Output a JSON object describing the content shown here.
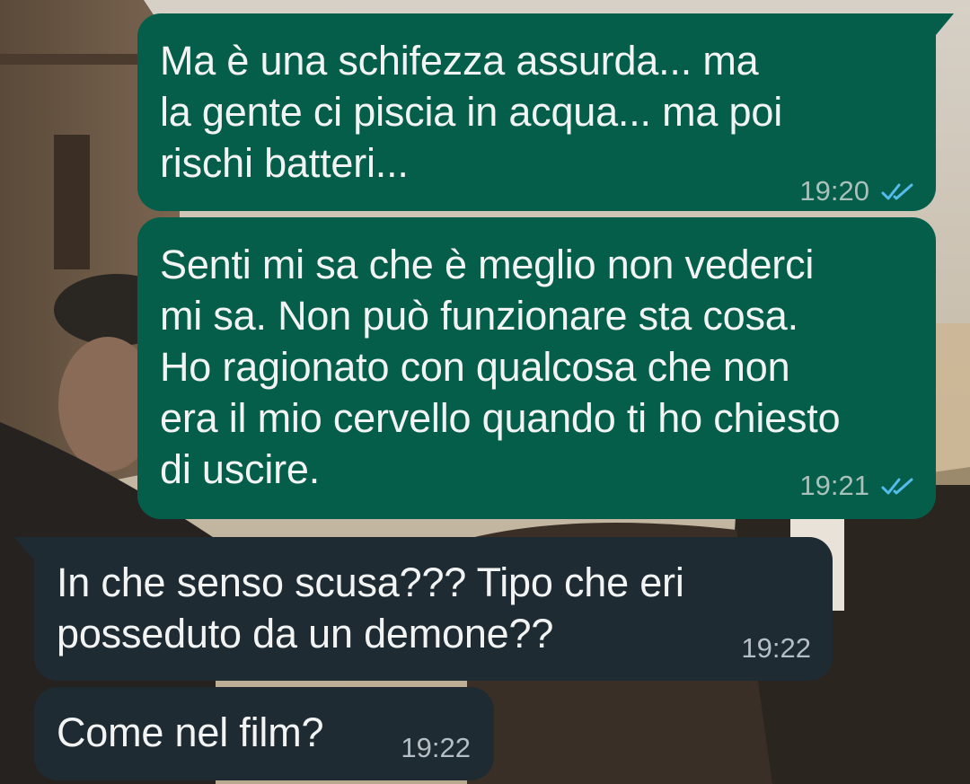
{
  "chat": {
    "messages": [
      {
        "direction": "outgoing",
        "text": "Ma è una schifezza assurda... ma\nla gente ci piscia in acqua... ma poi\nrischi batteri...",
        "time": "19:20",
        "status": "read",
        "status_icon": "double-check-icon"
      },
      {
        "direction": "outgoing",
        "text": "Senti mi sa che è meglio non vederci\nmi sa. Non può funzionare sta cosa.\nHo ragionato con qualcosa che non\nera il mio cervello quando ti ho chiesto\ndi uscire.",
        "time": "19:21",
        "status": "read",
        "status_icon": "double-check-icon"
      },
      {
        "direction": "incoming",
        "text": "In che senso scusa??? Tipo che eri\nposseduto da un demone??",
        "time": "19:22"
      },
      {
        "direction": "incoming",
        "text": "Come nel film?",
        "time": "19:22"
      }
    ]
  },
  "colors": {
    "outgoing_bubble": "#055e4a",
    "incoming_bubble": "#1f2b33",
    "read_ticks": "#53bdeb",
    "text": "#f2f4f3"
  }
}
